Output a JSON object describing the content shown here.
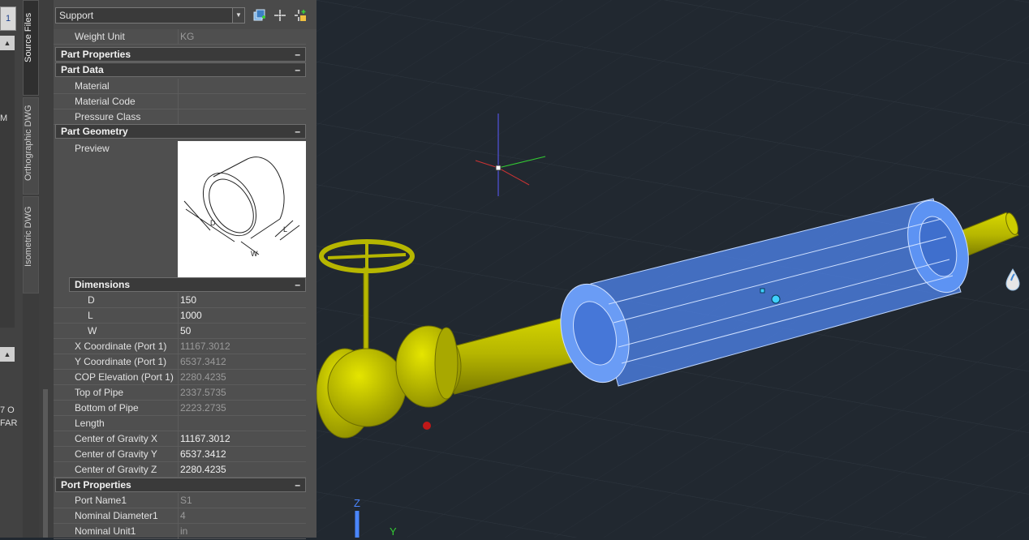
{
  "left": {
    "tiny_button": "1",
    "fragment_1": "M",
    "fragment_2": "7 O",
    "fragment_3": "FAR"
  },
  "tabs": [
    "Source Files",
    "Orthographic DWG",
    "Isometric DWG"
  ],
  "toolbar": {
    "dropdown_value": "Support"
  },
  "top_row": {
    "label": "Weight Unit",
    "value": "KG"
  },
  "sections": {
    "part_properties": "Part Properties",
    "part_data": "Part Data",
    "part_geometry": "Part Geometry",
    "dimensions": "Dimensions",
    "port_properties": "Port Properties",
    "collapse_symbol": "–"
  },
  "part_data": [
    {
      "label": "Material",
      "value": ""
    },
    {
      "label": "Material Code",
      "value": ""
    },
    {
      "label": "Pressure Class",
      "value": ""
    }
  ],
  "preview": {
    "label": "Preview",
    "dim_d": "D",
    "dim_w": "W",
    "dim_l": "L"
  },
  "dimensions": [
    {
      "label": "D",
      "value": "150"
    },
    {
      "label": "L",
      "value": "1000"
    },
    {
      "label": "W",
      "value": "50"
    }
  ],
  "geometry_rows": [
    {
      "label": "X Coordinate (Port 1)",
      "value": "11167.3012"
    },
    {
      "label": "Y Coordinate (Port 1)",
      "value": "6537.3412"
    },
    {
      "label": "COP Elevation (Port 1)",
      "value": "2280.4235"
    },
    {
      "label": "Top of Pipe",
      "value": "2337.5735"
    },
    {
      "label": "Bottom of Pipe",
      "value": "2223.2735"
    },
    {
      "label": "Length",
      "value": ""
    },
    {
      "label": "Center of Gravity X",
      "value": "11167.3012"
    },
    {
      "label": "Center of Gravity Y",
      "value": "6537.3412"
    },
    {
      "label": "Center of Gravity Z",
      "value": "2280.4235"
    }
  ],
  "port_properties": [
    {
      "label": "Port Name1",
      "value": "S1"
    },
    {
      "label": "Nominal Diameter1",
      "value": "4"
    },
    {
      "label": "Nominal Unit1",
      "value": "in"
    }
  ],
  "viewport": {
    "axis_z": "Z",
    "axis_y": "Y"
  },
  "colors": {
    "viewport_bg": "#212830",
    "pipe": "#b8b800",
    "selection": "#4f86f0",
    "panel_bg": "#4f4f4f"
  }
}
